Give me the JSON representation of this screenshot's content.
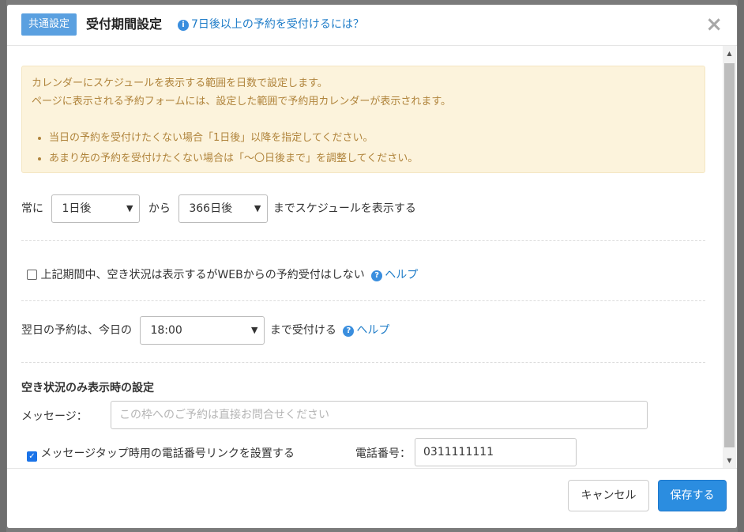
{
  "header": {
    "badge": "共通設定",
    "title": "受付期間設定",
    "help_icon": "info-circle",
    "help_link": "7日後以上の予約を受付けるには？",
    "close_icon": "×"
  },
  "notice": {
    "lines": [
      "カレンダーにスケジュールを表示する範囲を日数で設定します。",
      "ページに表示される予約フォームには、設定した範囲で予約用カレンダーが表示されます。"
    ],
    "bullets": [
      "当日の予約を受付けたくない場合「1日後」以降を指定してください。",
      "あまり先の予約を受付けたくない場合は「～〇日後まで」を調整してください。"
    ]
  },
  "range": {
    "prefix": "常に",
    "from_value": "1日後",
    "middle": "から",
    "to_value": "366日後",
    "suffix": "までスケジュールを表示する"
  },
  "web_block": {
    "checked": false,
    "label": "上記期間中、空き状況は表示するがWEBからの予約受付はしない",
    "help": "ヘルプ"
  },
  "next_day": {
    "prefix": "翌日の予約は、今日の",
    "time_value": "18:00",
    "suffix": "まで受付ける",
    "help": "ヘルプ"
  },
  "availability": {
    "section_title": "空き状況のみ表示時の設定",
    "message_label": "メッセージ：",
    "message_placeholder": "この枠へのご予約は直接お問合せください",
    "phone_link_checked": true,
    "phone_link_label": "メッセージタップ時用の電話番号リンクを設置する",
    "phone_label": "電話番号：",
    "phone_value": "0311111111"
  },
  "footer": {
    "cancel": "キャンセル",
    "save": "保存する"
  },
  "colors": {
    "accent": "#2b8de0",
    "notice_bg": "#fcf3dc",
    "notice_text": "#b0843c",
    "link": "#1e7cc8"
  }
}
